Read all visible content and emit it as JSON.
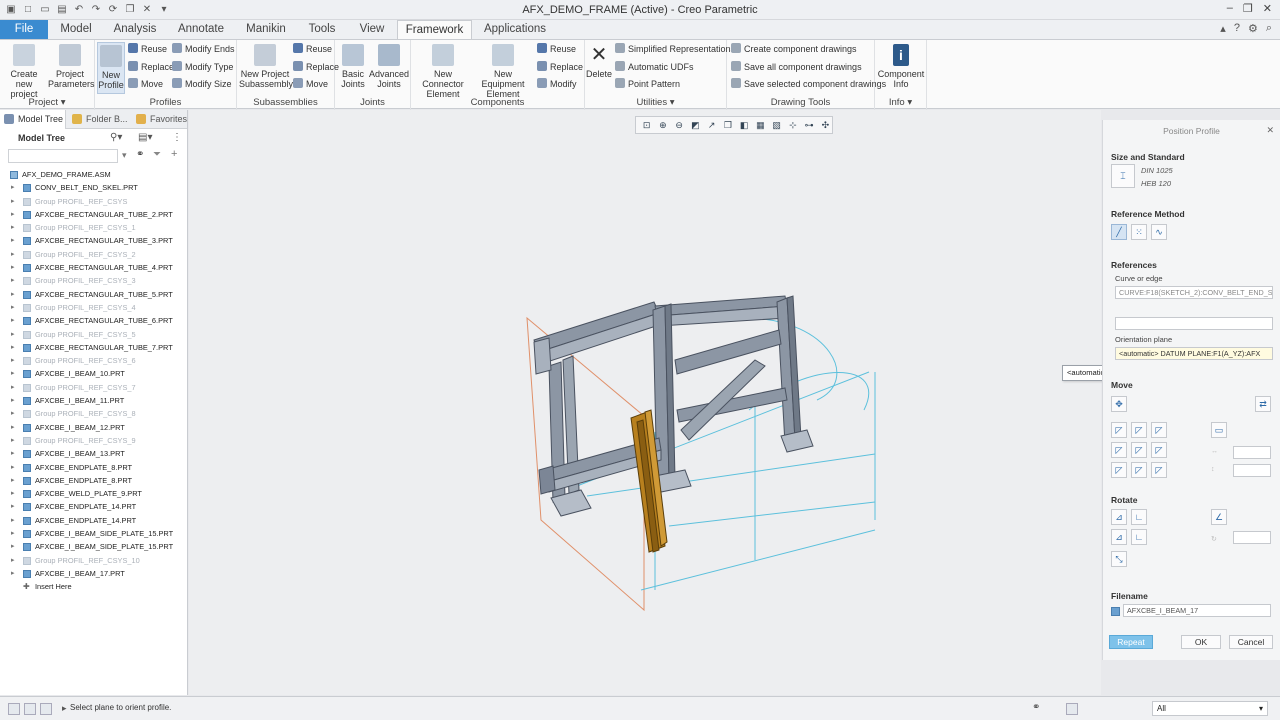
{
  "window": {
    "title": "AFX_DEMO_FRAME (Active) - Creo Parametric"
  },
  "tabs": [
    "File",
    "Model",
    "Analysis",
    "Annotate",
    "Manikin",
    "Tools",
    "View",
    "Framework",
    "Applications"
  ],
  "ribbon": {
    "project": {
      "create": "Create new project",
      "params": "Project Parameters",
      "label": "Project"
    },
    "profiles": {
      "new_profile": "New Profile",
      "reuse": "Reuse",
      "replace": "Replace",
      "move": "Move",
      "modify_ends": "Modify Ends",
      "modify_type": "Modify Type",
      "modify_size": "Modify Size",
      "label": "Profiles"
    },
    "subassemblies": {
      "new_project_sub": "New Project Subassembly",
      "reuse": "Reuse",
      "replace": "Replace",
      "move": "Move",
      "label": "Subassemblies"
    },
    "joints": {
      "basic": "Basic Joints",
      "advanced": "Advanced Joints",
      "label": "Joints"
    },
    "components": {
      "new_connector": "New Connector Element",
      "new_equipment": "New Equipment Element",
      "reuse": "Reuse",
      "replace": "Replace",
      "modify": "Modify",
      "label": "Components"
    },
    "utilities": {
      "delete": "Delete",
      "simplified": "Simplified Representations",
      "auto_udfs": "Automatic UDFs",
      "point_pattern": "Point Pattern",
      "label": "Utilities"
    },
    "drawing_tools": {
      "create_drawings": "Create component drawings",
      "save_all": "Save all component drawings",
      "save_selected": "Save selected component drawings",
      "label": "Drawing Tools"
    },
    "info": {
      "component_info": "Component Info",
      "label": "Info"
    }
  },
  "left_panel": {
    "tabs": [
      "Model Tree",
      "Folder B...",
      "Favorites"
    ],
    "header": "Model Tree",
    "items": [
      {
        "label": "AFX_DEMO_FRAME.ASM",
        "kind": "root"
      },
      {
        "label": "CONV_BELT_END_SKEL.PRT",
        "kind": "part"
      },
      {
        "label": "Group PROFIL_REF_CSYS",
        "kind": "dim"
      },
      {
        "label": "AFXCBE_RECTANGULAR_TUBE_2.PRT",
        "kind": "part"
      },
      {
        "label": "Group PROFIL_REF_CSYS_1",
        "kind": "dim"
      },
      {
        "label": "AFXCBE_RECTANGULAR_TUBE_3.PRT",
        "kind": "part"
      },
      {
        "label": "Group PROFIL_REF_CSYS_2",
        "kind": "dim"
      },
      {
        "label": "AFXCBE_RECTANGULAR_TUBE_4.PRT",
        "kind": "part"
      },
      {
        "label": "Group PROFIL_REF_CSYS_3",
        "kind": "dim"
      },
      {
        "label": "AFXCBE_RECTANGULAR_TUBE_5.PRT",
        "kind": "part"
      },
      {
        "label": "Group PROFIL_REF_CSYS_4",
        "kind": "dim"
      },
      {
        "label": "AFXCBE_RECTANGULAR_TUBE_6.PRT",
        "kind": "part"
      },
      {
        "label": "Group PROFIL_REF_CSYS_5",
        "kind": "dim"
      },
      {
        "label": "AFXCBE_RECTANGULAR_TUBE_7.PRT",
        "kind": "part"
      },
      {
        "label": "Group PROFIL_REF_CSYS_6",
        "kind": "dim"
      },
      {
        "label": "AFXCBE_I_BEAM_10.PRT",
        "kind": "part"
      },
      {
        "label": "Group PROFIL_REF_CSYS_7",
        "kind": "dim"
      },
      {
        "label": "AFXCBE_I_BEAM_11.PRT",
        "kind": "part"
      },
      {
        "label": "Group PROFIL_REF_CSYS_8",
        "kind": "dim"
      },
      {
        "label": "AFXCBE_I_BEAM_12.PRT",
        "kind": "part"
      },
      {
        "label": "Group PROFIL_REF_CSYS_9",
        "kind": "dim"
      },
      {
        "label": "AFXCBE_I_BEAM_13.PRT",
        "kind": "part"
      },
      {
        "label": "AFXCBE_ENDPLATE_8.PRT",
        "kind": "part"
      },
      {
        "label": "AFXCBE_ENDPLATE_8.PRT",
        "kind": "part"
      },
      {
        "label": "AFXCBE_WELD_PLATE_9.PRT",
        "kind": "part"
      },
      {
        "label": "AFXCBE_ENDPLATE_14.PRT",
        "kind": "part"
      },
      {
        "label": "AFXCBE_ENDPLATE_14.PRT",
        "kind": "part"
      },
      {
        "label": "AFXCBE_I_BEAM_SIDE_PLATE_15.PRT",
        "kind": "part"
      },
      {
        "label": "AFXCBE_I_BEAM_SIDE_PLATE_15.PRT",
        "kind": "part"
      },
      {
        "label": "Group PROFIL_REF_CSYS_10",
        "kind": "dim"
      },
      {
        "label": "AFXCBE_I_BEAM_17.PRT",
        "kind": "part"
      },
      {
        "label": "Insert Here",
        "kind": "insert"
      }
    ]
  },
  "position_profile": {
    "title": "Position Profile",
    "size_standard_label": "Size and Standard",
    "standard": "DIN 1025",
    "size": "HEB 120",
    "reference_method_label": "Reference Method",
    "references_label": "References",
    "curve_label": "Curve or edge",
    "curve_value": "CURVE:F18(SKETCH_2):CONV_BELT_END_SK",
    "orientation_label": "Orientation plane",
    "orientation_value": "<automatic> DATUM PLANE:F1(A_YZ):AFX",
    "tooltip": "<automatic> DATUM PLANE:F1(A_YZ):AFX_DEMO_FRAME",
    "move_label": "Move",
    "rotate_label": "Rotate",
    "filename_label": "Filename",
    "filename_value": "AFXCBE_I_BEAM_17",
    "repeat": "Repeat",
    "ok": "OK",
    "cancel": "Cancel"
  },
  "status": {
    "message": "Select plane to orient profile.",
    "filter": "All"
  },
  "colors": {
    "accent": "#3a8bd0",
    "steel": "#8c96a4",
    "beam": "#b8801e",
    "datum": "#e0906a",
    "curve": "#5cc0dc"
  }
}
